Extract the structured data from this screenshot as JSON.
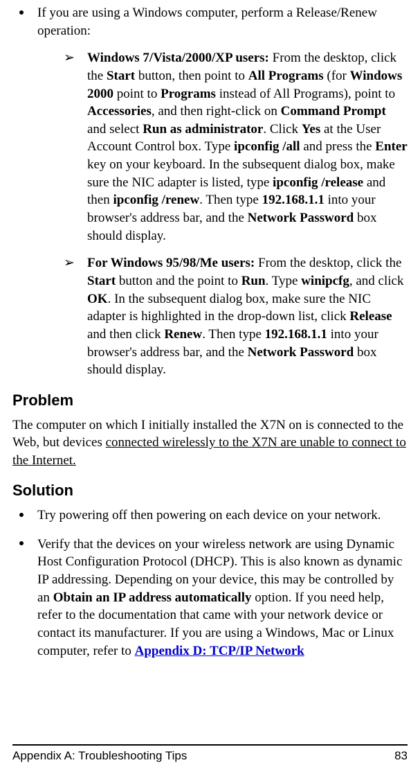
{
  "bullets": {
    "b1_intro": "If you are using a Windows computer, perform a Release/Renew operation:",
    "sub1": {
      "lead": "Windows 7/Vista/2000/XP users:",
      "t1": " From the desktop, click the ",
      "start": "Start",
      "t2": " button, then point to ",
      "allprograms": "All Programs",
      "t3": " (for ",
      "win2000": "Windows 2000",
      "t4": " point to ",
      "programs": "Programs",
      "t5": " instead of All Programs), point to ",
      "accessories": "Accessories",
      "t6": ", and then right-click on ",
      "cmdprompt": "Command Prompt",
      "t7": " and select ",
      "runadmin": "Run as administrator",
      "t8": ". Click ",
      "yes": "Yes",
      "t9": " at the User Account Control box. Type ",
      "ipall": "ipconfig /all",
      "t10": " and press the ",
      "enter": "Enter",
      "t11": " key on your keyboard. In the subsequent dialog box, make sure the NIC adapter is listed, type ",
      "release": "ipconfig /release",
      "t12": " and then ",
      "renew": "ipconfig /renew",
      "t13": ". Then type ",
      "ip": "192.168.1.1",
      "t14": " into your browser's address bar, and the ",
      "netpass": "Network Password",
      "t15": " box should display."
    },
    "sub2": {
      "lead": "For Windows 95/98/Me users:",
      "t1": " From the desktop, click the ",
      "start": "Start",
      "t2": " button and the point to ",
      "run": "Run",
      "t3": ". Type ",
      "winipcfg": "winipcfg",
      "t4": ", and click ",
      "ok": "OK",
      "t5": ". In the subsequent dialog box, make sure the NIC adapter is highlighted in the drop-down list, click ",
      "release": "Release",
      "t6": " and then click ",
      "renew": "Renew",
      "t7": ". Then type ",
      "ip": "192.168.1.1",
      "t8": " into your browser's address bar, and the ",
      "netpass": "Network Password",
      "t9": " box should display."
    }
  },
  "problem_h": "Problem",
  "problem_p": {
    "t1": "The computer on which I initially installed the X7N on is connected to the Web, but devices ",
    "u": "connected wirelessly to the X7N are unable to connect to the Internet."
  },
  "solution_h": "Solution",
  "sol1": "Try powering off then powering on each device on your network.",
  "sol2": {
    "t1": "Verify that the devices on your wireless network are using Dynamic Host Configuration Protocol (DHCP). This is also known as dynamic IP addressing. Depending on your device, this may be controlled by an ",
    "obtain": "Obtain an IP address automatically",
    "t2": " option. If you need help, refer to the documentation that came with your network device or contact its manufacturer. If you are using a Windows, Mac or Linux computer, refer to ",
    "link": "Appendix D: TCP/IP Network"
  },
  "footer_left": "Appendix A: Troubleshooting Tips",
  "footer_right": "83"
}
